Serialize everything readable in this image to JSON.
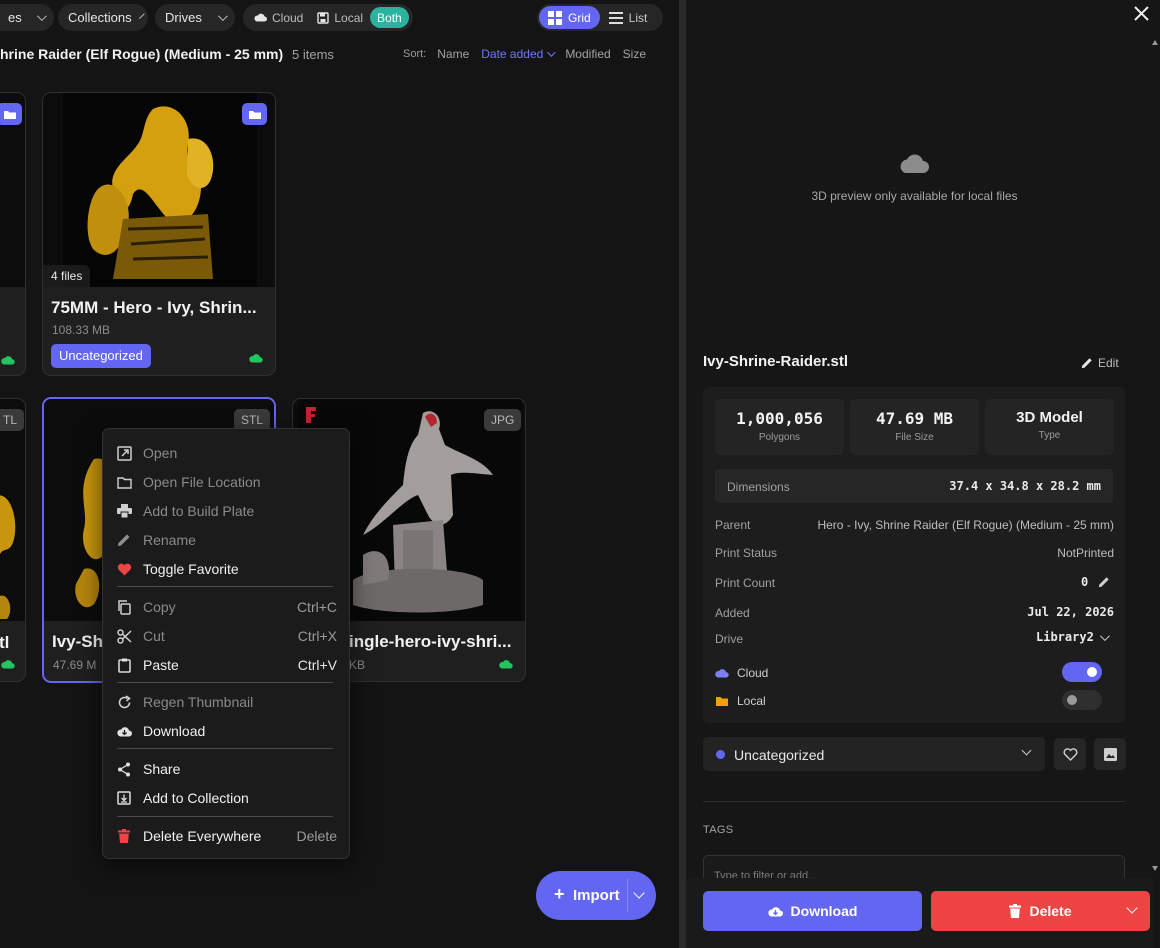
{
  "toolbar": {
    "filter1_label": "es",
    "collections_label": "Collections",
    "drives_label": "Drives",
    "source": {
      "cloud": "Cloud",
      "local": "Local",
      "both": "Both"
    },
    "view": {
      "grid": "Grid",
      "list": "List"
    }
  },
  "header": {
    "title": "hrine Raider (Elf Rogue) (Medium - 25 mm)",
    "count": "5 items",
    "sort_label": "Sort:",
    "sort_options": [
      "Name",
      "Date added",
      "Modified",
      "Size"
    ],
    "sort_active": "Date added"
  },
  "cards": {
    "folder": {
      "files": "4 files",
      "title": "75MM - Hero - Ivy, Shrin...",
      "size": "108.33 MB",
      "tag": "Uncategorized"
    },
    "selected": {
      "ext": "STL",
      "title": "Ivy-Sh",
      "size": "47.69 M"
    },
    "jpg": {
      "ext": "JPG",
      "title": "ingle-hero-ivy-shri...",
      "size": "KB"
    },
    "left_partial_title": "tl",
    "left_partial_ext": "TL"
  },
  "context_menu": {
    "items": [
      {
        "label": "Open",
        "shortcut": "",
        "icon": "open-external-icon"
      },
      {
        "label": "Open File Location",
        "shortcut": "",
        "icon": "folder-icon"
      },
      {
        "label": "Add to Build Plate",
        "shortcut": "",
        "icon": "printer-icon"
      },
      {
        "label": "Rename",
        "shortcut": "",
        "icon": "pencil-icon"
      },
      {
        "label": "Toggle Favorite",
        "shortcut": "",
        "icon": "heart-icon"
      },
      {
        "label": "Copy",
        "shortcut": "Ctrl+C",
        "icon": "copy-icon"
      },
      {
        "label": "Cut",
        "shortcut": "Ctrl+X",
        "icon": "scissors-icon"
      },
      {
        "label": "Paste",
        "shortcut": "Ctrl+V",
        "icon": "clipboard-icon"
      },
      {
        "label": "Regen Thumbnail",
        "shortcut": "",
        "icon": "refresh-icon"
      },
      {
        "label": "Download",
        "shortcut": "",
        "icon": "cloud-download-icon"
      },
      {
        "label": "Share",
        "shortcut": "",
        "icon": "share-icon"
      },
      {
        "label": "Add to Collection",
        "shortcut": "",
        "icon": "add-to-collection-icon"
      },
      {
        "label": "Delete Everywhere",
        "shortcut": "Delete",
        "icon": "trash-icon"
      }
    ]
  },
  "fab": {
    "label": "Import"
  },
  "panel": {
    "preview_note": "3D preview only available for local files",
    "filename": "Ivy-Shrine-Raider.stl",
    "edit_label": "Edit",
    "stats": [
      {
        "value": "1,000,056",
        "label": "Polygons"
      },
      {
        "value": "47.69 MB",
        "label": "File Size"
      },
      {
        "value": "3D Model",
        "label": "Type"
      }
    ],
    "dimensions_label": "Dimensions",
    "dimensions_value": "37.4 x 34.8 x 28.2 mm",
    "parent_label": "Parent",
    "parent_value": "Hero - Ivy, Shrine Raider (Elf Rogue) (Medium - 25 mm)",
    "print_status_label": "Print Status",
    "print_status_value": "NotPrinted",
    "print_count_label": "Print Count",
    "print_count_value": "0",
    "added_label": "Added",
    "added_value": "Jul 22, 2026",
    "drive_label": "Drive",
    "drive_value": "Library2",
    "cloud_label": "Cloud",
    "cloud_on": true,
    "local_label": "Local",
    "local_on": false,
    "category": "Uncategorized",
    "tags_label": "TAGS",
    "tags_placeholder": "Type to filter or add...",
    "download_label": "Download",
    "delete_label": "Delete"
  },
  "colors": {
    "accent": "#6366f1",
    "teal": "#2bb3a0",
    "danger": "#ef4444",
    "cloud_ok": "#22c55e"
  }
}
